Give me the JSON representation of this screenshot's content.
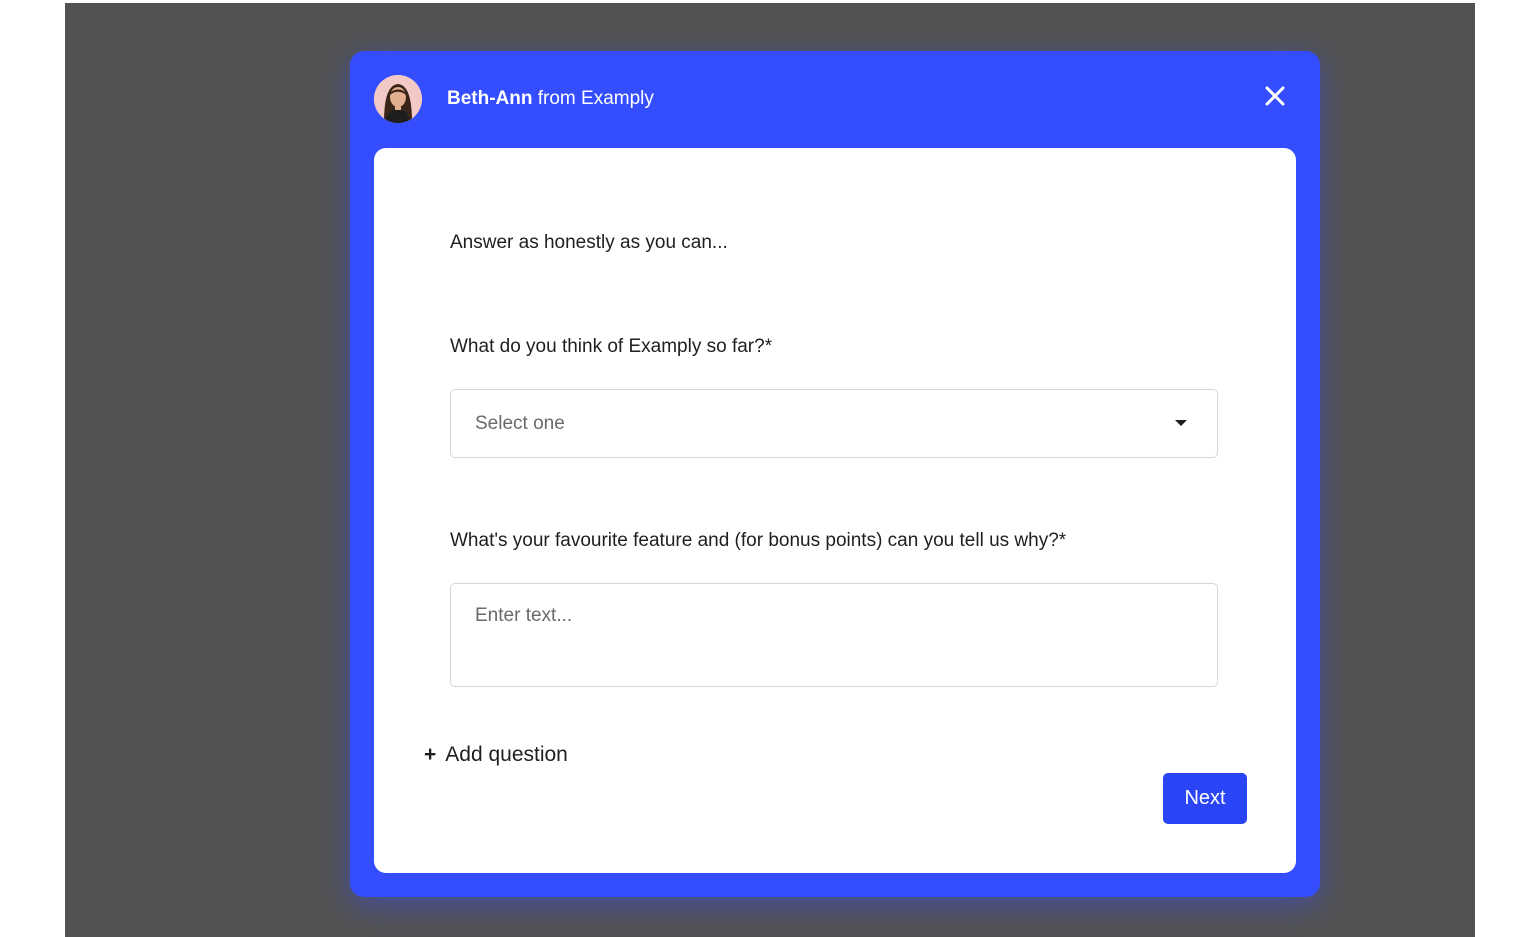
{
  "header": {
    "sender_name": "Beth-Ann",
    "sender_suffix": " from Examply",
    "avatar": "avatar-photo",
    "close_icon": "close-icon"
  },
  "form": {
    "intro": "Answer as honestly as you can...",
    "question_1": {
      "label": "What do you think of Examply so far?*",
      "select_value": "Select one"
    },
    "question_2": {
      "label": "What's your favourite feature and (for bonus points) can you tell us why?*",
      "placeholder": "Enter text..."
    },
    "add_question_label": "Add question",
    "add_question_icon": "+",
    "next_label": "Next"
  },
  "colors": {
    "backdrop": "#525252",
    "brand_blue": "#334dff",
    "button_blue": "#2a45f5",
    "card": "#ffffff"
  }
}
